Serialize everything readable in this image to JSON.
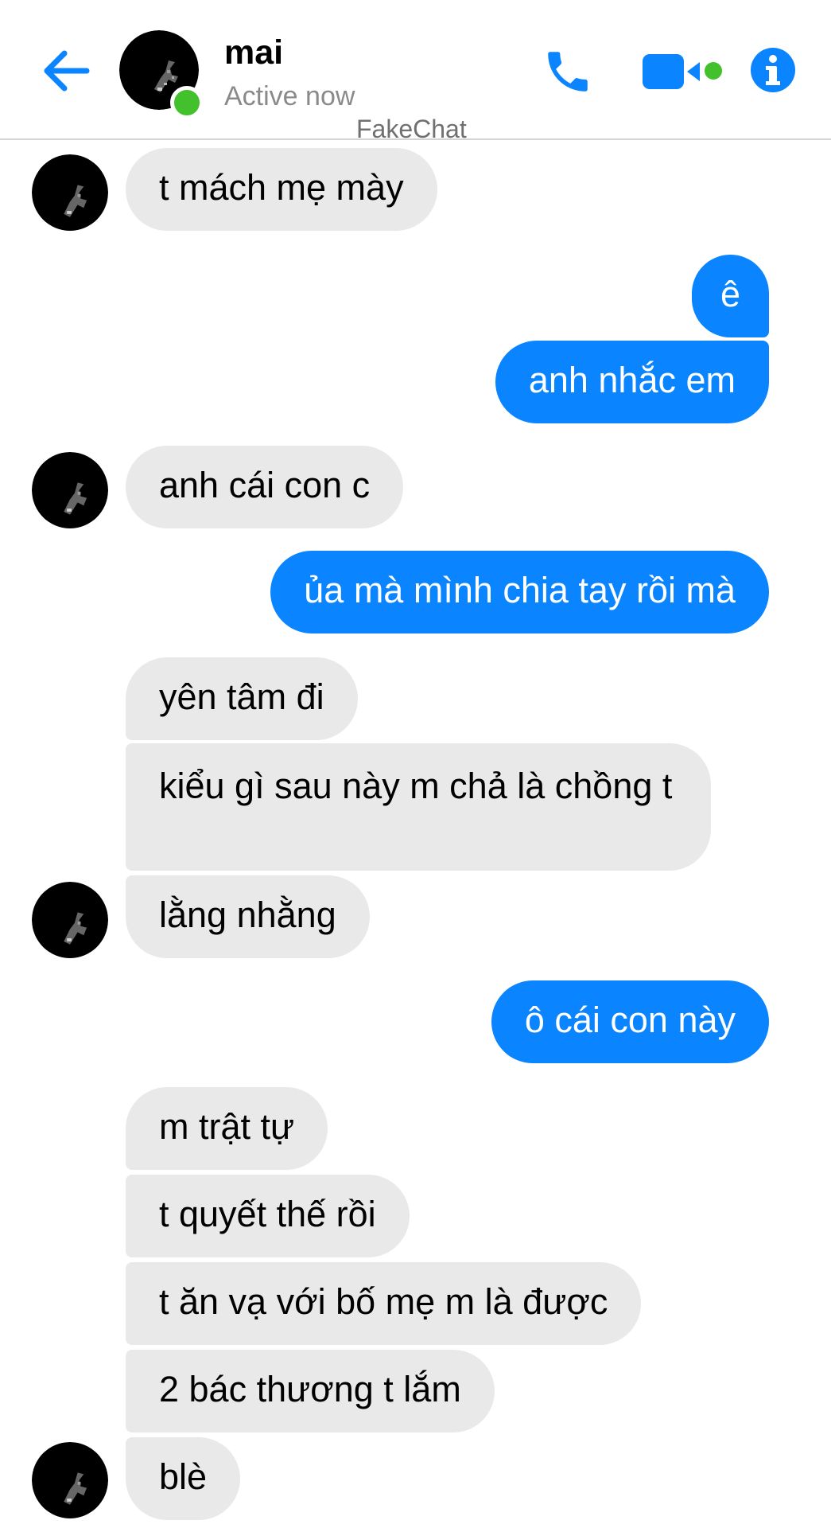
{
  "header": {
    "contact_name": "mai",
    "status": "Active now",
    "watermark": "FakeChat",
    "back_icon": "arrow-left-icon",
    "call_icon": "phone-icon",
    "video_icon": "video-camera-icon",
    "info_icon": "info-icon",
    "accent_color": "#0a84ff",
    "online_color": "#43c12d"
  },
  "messages": [
    {
      "sender": "mai",
      "text": "t mách mẹ mày"
    },
    {
      "sender": "me",
      "text": "ê"
    },
    {
      "sender": "me",
      "text": "anh nhắc em"
    },
    {
      "sender": "mai",
      "text": "anh cái con c"
    },
    {
      "sender": "me",
      "text": "ủa mà mình chia tay rồi mà"
    },
    {
      "sender": "mai",
      "text": "yên tâm đi"
    },
    {
      "sender": "mai",
      "text": "kiểu gì sau này m chả là chồng t"
    },
    {
      "sender": "mai",
      "text": "lằng nhằng"
    },
    {
      "sender": "me",
      "text": "ô cái con này"
    },
    {
      "sender": "mai",
      "text": "m trật tự"
    },
    {
      "sender": "mai",
      "text": "t quyết thế rồi"
    },
    {
      "sender": "mai",
      "text": "t ăn vạ với bố mẹ m là được"
    },
    {
      "sender": "mai",
      "text": "2 bác thương t lắm"
    },
    {
      "sender": "mai",
      "text": "blè"
    }
  ],
  "colors": {
    "incoming_bubble": "#e9e9e9",
    "outgoing_bubble": "#0a84ff"
  }
}
